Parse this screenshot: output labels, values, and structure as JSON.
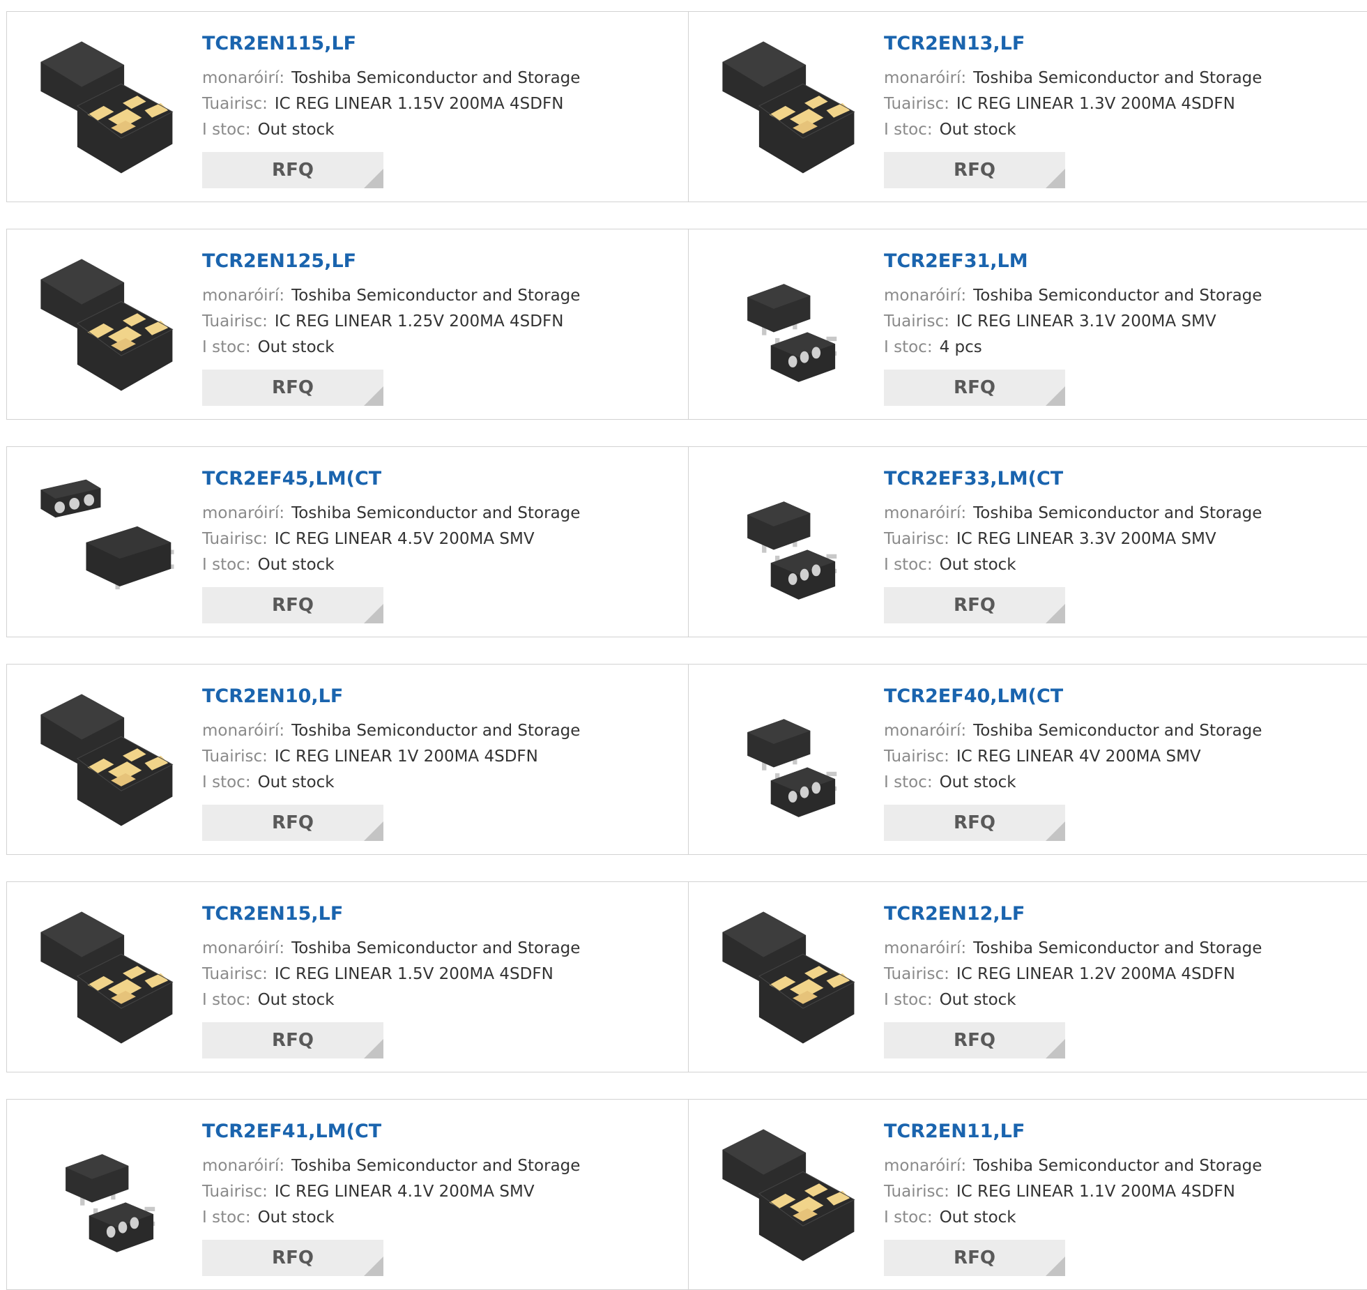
{
  "labels": {
    "manufacturer": "monaróirí:",
    "description": "Tuairisc:",
    "stock": "I stoc:",
    "rfq": "RFQ"
  },
  "products": [
    {
      "part": "TCR2EN115,LF",
      "manufacturer": "Toshiba Semiconductor and Storage",
      "description": "IC REG LINEAR 1.15V 200MA 4SDFN",
      "stock": "Out stock",
      "image": "sdfn-package-icon"
    },
    {
      "part": "TCR2EN13,LF",
      "manufacturer": "Toshiba Semiconductor and Storage",
      "description": "IC REG LINEAR 1.3V 200MA 4SDFN",
      "stock": "Out stock",
      "image": "sdfn-package-icon"
    },
    {
      "part": "TCR2EN125,LF",
      "manufacturer": "Toshiba Semiconductor and Storage",
      "description": "IC REG LINEAR 1.25V 200MA 4SDFN",
      "stock": "Out stock",
      "image": "sdfn-package-icon"
    },
    {
      "part": "TCR2EF31,LM",
      "manufacturer": "Toshiba Semiconductor and Storage",
      "description": "IC REG LINEAR 3.1V 200MA SMV",
      "stock": "4 pcs",
      "image": "smv-package-icon"
    },
    {
      "part": "TCR2EF45,LM(CT",
      "manufacturer": "Toshiba Semiconductor and Storage",
      "description": "IC REG LINEAR 4.5V 200MA SMV",
      "stock": "Out stock",
      "image": "smv-package-alt-icon"
    },
    {
      "part": "TCR2EF33,LM(CT",
      "manufacturer": "Toshiba Semiconductor and Storage",
      "description": "IC REG LINEAR 3.3V 200MA SMV",
      "stock": "Out stock",
      "image": "smv-package-icon"
    },
    {
      "part": "TCR2EN10,LF",
      "manufacturer": "Toshiba Semiconductor and Storage",
      "description": "IC REG LINEAR 1V 200MA 4SDFN",
      "stock": "Out stock",
      "image": "sdfn-package-icon"
    },
    {
      "part": "TCR2EF40,LM(CT",
      "manufacturer": "Toshiba Semiconductor and Storage",
      "description": "IC REG LINEAR 4V 200MA SMV",
      "stock": "Out stock",
      "image": "smv-package-icon"
    },
    {
      "part": "TCR2EN15,LF",
      "manufacturer": "Toshiba Semiconductor and Storage",
      "description": "IC REG LINEAR 1.5V 200MA 4SDFN",
      "stock": "Out stock",
      "image": "sdfn-package-icon"
    },
    {
      "part": "TCR2EN12,LF",
      "manufacturer": "Toshiba Semiconductor and Storage",
      "description": "IC REG LINEAR 1.2V 200MA 4SDFN",
      "stock": "Out stock",
      "image": "sdfn-package-icon"
    },
    {
      "part": "TCR2EF41,LM(CT",
      "manufacturer": "Toshiba Semiconductor and Storage",
      "description": "IC REG LINEAR 4.1V 200MA SMV",
      "stock": "Out stock",
      "image": "smv-package-icon"
    },
    {
      "part": "TCR2EN11,LF",
      "manufacturer": "Toshiba Semiconductor and Storage",
      "description": "IC REG LINEAR 1.1V 200MA 4SDFN",
      "stock": "Out stock",
      "image": "sdfn-package-icon"
    }
  ]
}
